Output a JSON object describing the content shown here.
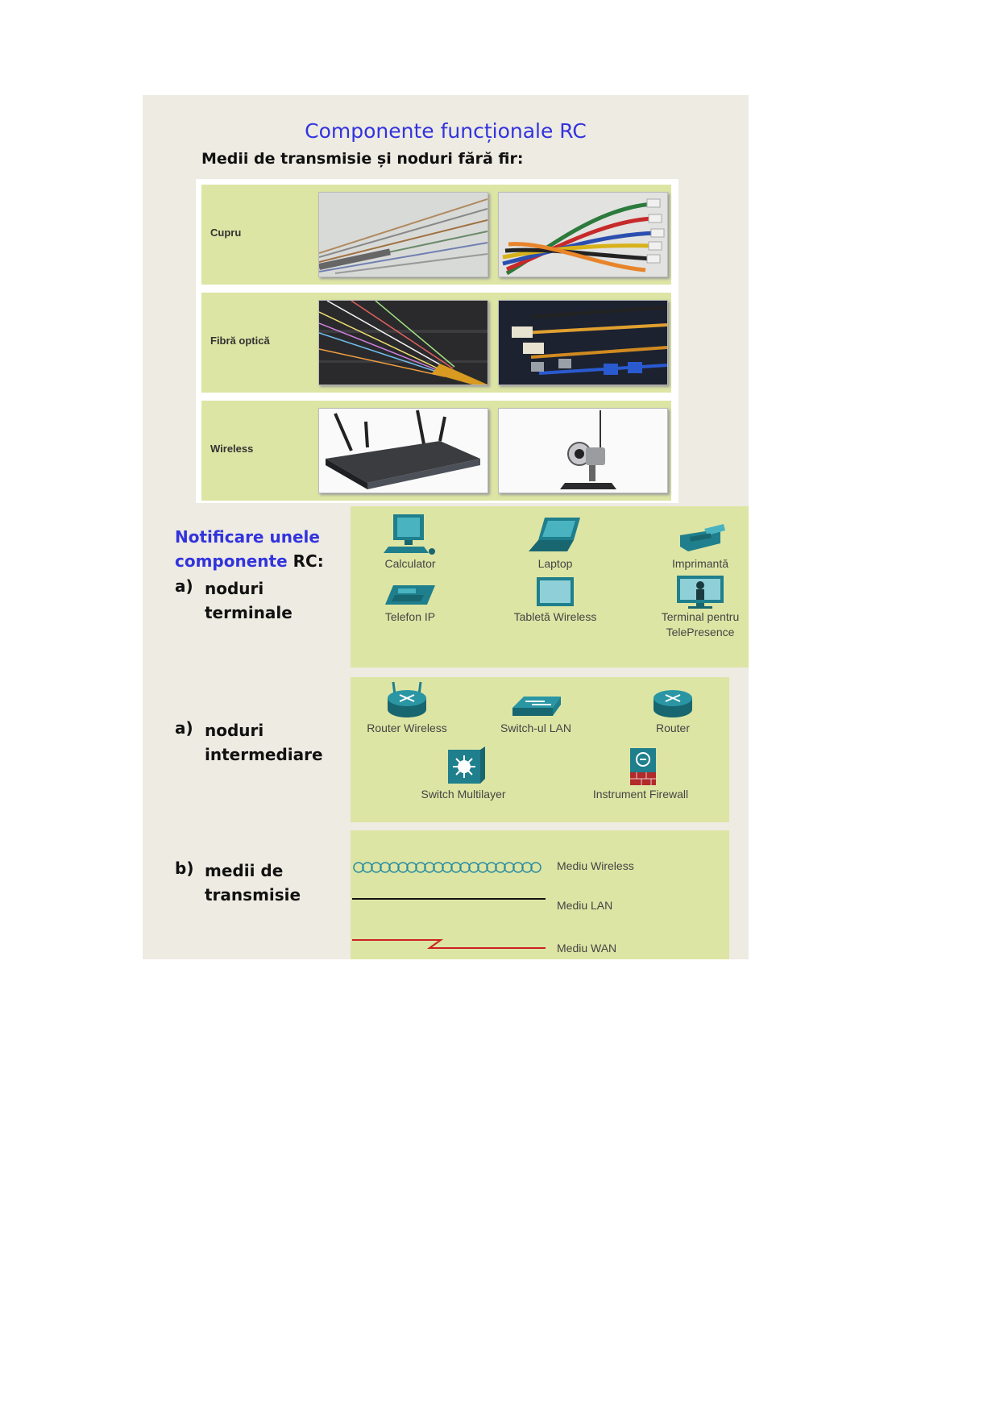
{
  "slide": {
    "title": "Componente funcționale RC",
    "subtitle": "Medii de transmisie și noduri fără fir:"
  },
  "media_rows": [
    {
      "label": "Cupru",
      "images": [
        "copper-cable-photo",
        "ethernet-patch-cables-photo"
      ]
    },
    {
      "label": "Fibră optică",
      "images": [
        "fiber-optic-strands-photo",
        "fiber-connectors-photo"
      ]
    },
    {
      "label": "Wireless",
      "images": [
        "wireless-router-photo",
        "wireless-webcam-photo"
      ]
    }
  ],
  "notation": {
    "heading_blue": "Notificare unele componente",
    "heading_tail": "RC:",
    "sections": [
      {
        "marker": "a)",
        "line1": "noduri",
        "line2": "terminale"
      },
      {
        "marker": "a)",
        "line1": "noduri",
        "line2": "intermediare"
      },
      {
        "marker": "b)",
        "line1": "medii de",
        "line2": "transmisie"
      }
    ]
  },
  "end_devices": [
    {
      "label": "Calculator",
      "icon": "desktop-computer-icon"
    },
    {
      "label": "Laptop",
      "icon": "laptop-icon"
    },
    {
      "label": "Imprimantă",
      "icon": "printer-icon"
    },
    {
      "label": "Telefon IP",
      "icon": "ip-phone-icon"
    },
    {
      "label": "Tabletă Wireless",
      "icon": "tablet-icon"
    },
    {
      "label": "Terminal pentru",
      "label2": "TelePresence",
      "icon": "telepresence-icon"
    }
  ],
  "intermediary_devices": [
    {
      "label": "Router Wireless",
      "icon": "wireless-router-icon"
    },
    {
      "label": "Switch-ul LAN",
      "icon": "lan-switch-icon"
    },
    {
      "label": "Router",
      "icon": "router-icon"
    },
    {
      "label": "Switch Multilayer",
      "icon": "multilayer-switch-icon"
    },
    {
      "label": "Instrument Firewall",
      "icon": "firewall-icon"
    }
  ],
  "media_types": [
    {
      "label": "Mediu Wireless",
      "color": "#2a8ca0"
    },
    {
      "label": "Mediu LAN",
      "color": "#111111"
    },
    {
      "label": "Mediu WAN",
      "color": "#cc2222"
    }
  ],
  "colors": {
    "accent": "#3333dd",
    "panel": "#dde5a4",
    "slide": "#edebe2",
    "icon_teal": "#1f7f8c"
  }
}
